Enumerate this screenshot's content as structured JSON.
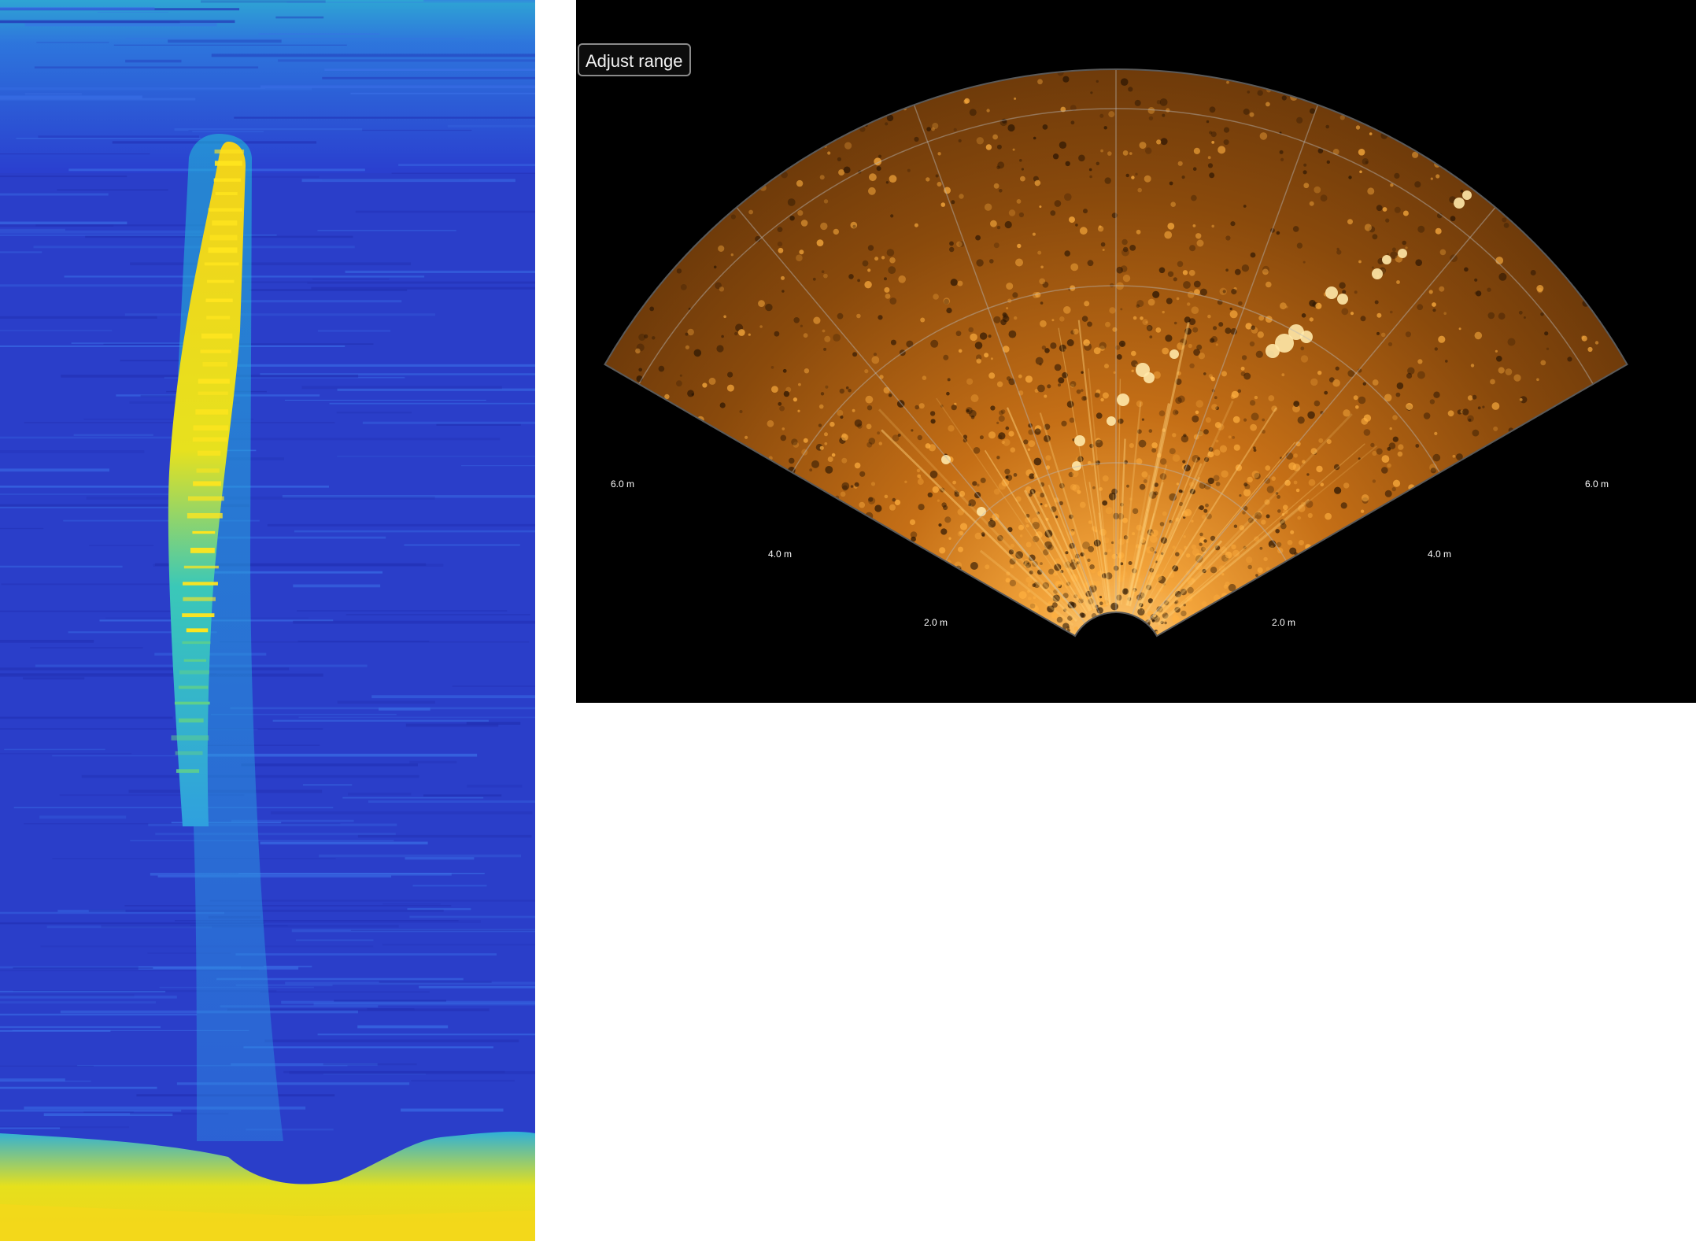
{
  "sonar": {
    "adjust_range_label": "Adjust range",
    "range_labels": [
      "2.0 m",
      "4.0 m",
      "6.0 m"
    ]
  },
  "colors": {
    "echogram_background": "#2a38c9",
    "echogram_highlight": "#f2d21a",
    "sonar_background": "#000000",
    "sonar_echo": "#e08a1e"
  }
}
